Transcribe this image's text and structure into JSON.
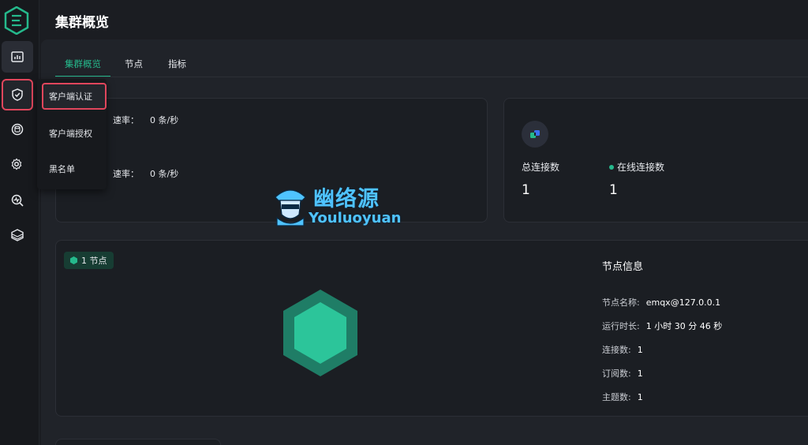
{
  "header": {
    "title": "集群概览"
  },
  "tabs": [
    {
      "label": "集群概览",
      "active": true
    },
    {
      "label": "节点"
    },
    {
      "label": "指标"
    }
  ],
  "sidebar": {
    "items": [
      {
        "icon": "dashboard-icon"
      },
      {
        "icon": "shield-icon",
        "highlighted": true
      },
      {
        "icon": "database-icon"
      },
      {
        "icon": "settings-gear-icon"
      },
      {
        "icon": "diagnose-icon"
      },
      {
        "icon": "layers-icon"
      }
    ]
  },
  "menu": {
    "items": [
      {
        "label": "客户端认证",
        "highlighted": true
      },
      {
        "label": "客户端授权"
      },
      {
        "label": "黑名单"
      }
    ]
  },
  "rates": {
    "row1": {
      "label": "速率：",
      "value": "0 条/秒"
    },
    "row2": {
      "label": "速率：",
      "value": "0 条/秒"
    }
  },
  "connections": {
    "total_label": "总连接数",
    "total_value": "1",
    "online_label": "在线连接数",
    "online_value": "1"
  },
  "nodes": {
    "badge": "1 节点",
    "info_title": "节点信息",
    "info": [
      {
        "label": "节点名称:",
        "value": "emqx@127.0.0.1"
      },
      {
        "label": "运行时长:",
        "value": "1 小时 30 分 46 秒"
      },
      {
        "label": "连接数:",
        "value": "1"
      },
      {
        "label": "订阅数:",
        "value": "1"
      },
      {
        "label": "主题数:",
        "value": "1"
      }
    ]
  },
  "watermark": {
    "cn": "幽络源",
    "en": "Youluoyuan"
  },
  "colors": {
    "accent": "#25b98c",
    "highlight": "#e0465c",
    "watermark": "#4fc3ff"
  }
}
